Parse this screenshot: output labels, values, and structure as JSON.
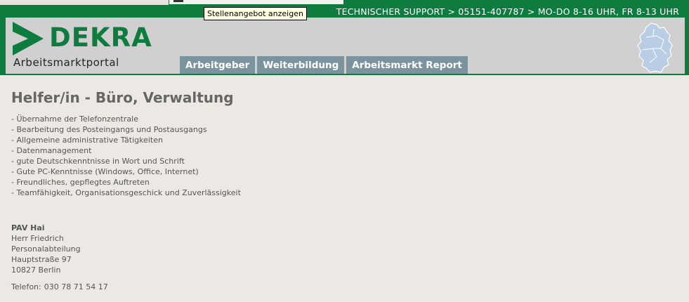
{
  "topbar": {
    "support_text": "TECHNISCHER SUPPORT > 05151-407787 > MO-DO 8-16 UHR, FR 8-13 UHR"
  },
  "tooltip": {
    "text": "Stellenangebot anzeigen"
  },
  "header": {
    "logo_text": "DEKRA",
    "portal_name": "Arbeitsmarktportal",
    "nav": [
      "Arbeitgeber",
      "Weiterbildung",
      "Arbeitsmarkt Report"
    ],
    "map_icon": "germany-map-icon",
    "brand_color": "#0e7c3f"
  },
  "job": {
    "title": "Helfer/in - Büro, Verwaltung",
    "duties": [
      "- Übernahme der Telefonzentrale",
      "- Bearbeitung des Posteingangs und Postausgangs",
      "- Allgemeine administrative Tätigkeiten",
      "- Datenmanagement",
      "- gute Deutschkenntnisse in Wort und Schrift",
      "- Gute PC-Kenntnisse (Windows, Office, Internet)",
      "- Freundliches, gepflegtes Auftreten",
      "- Teamfähigkeit, Organisationsgeschick und Zuverlässigkeit"
    ]
  },
  "contact": {
    "company": "PAV Hai",
    "person": "Herr Friedrich",
    "department": "Personalabteilung",
    "street": "Hauptstraße 97",
    "city": "10827 Berlin",
    "phone_label": "Telefon:",
    "phone_number": "030 78 71 54 17"
  }
}
